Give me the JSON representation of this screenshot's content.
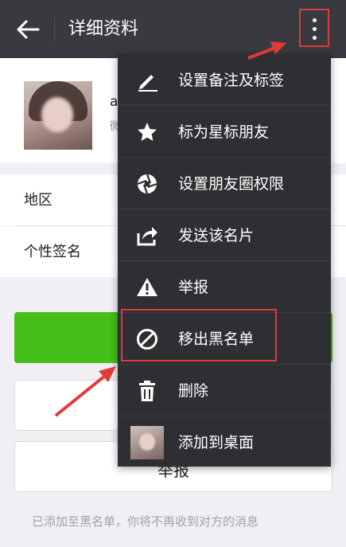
{
  "topbar": {
    "title": "详细资料"
  },
  "profile": {
    "nickname": "a",
    "sub": "微"
  },
  "rows": [
    {
      "label": "地区"
    },
    {
      "label": "个性签名"
    }
  ],
  "buttons": {
    "report": "举报"
  },
  "footnote": "已添加至黑名单，你将不再收到对方的消息",
  "menu": {
    "items": [
      {
        "label": "设置备注及标签",
        "icon": "pencil-icon"
      },
      {
        "label": "标为星标朋友",
        "icon": "star-icon"
      },
      {
        "label": "设置朋友圈权限",
        "icon": "aperture-icon"
      },
      {
        "label": "发送该名片",
        "icon": "share-icon"
      },
      {
        "label": "举报",
        "icon": "warning-icon"
      },
      {
        "label": "移出黑名单",
        "icon": "block-icon"
      },
      {
        "label": "删除",
        "icon": "trash-icon"
      },
      {
        "label": "添加到桌面",
        "icon": "avatar-thumbnail"
      }
    ]
  },
  "colors": {
    "topbar": "#393a3f",
    "menu": "#2e2f33",
    "accent_green": "#45c01a",
    "annotation_red": "#e03a3a"
  }
}
